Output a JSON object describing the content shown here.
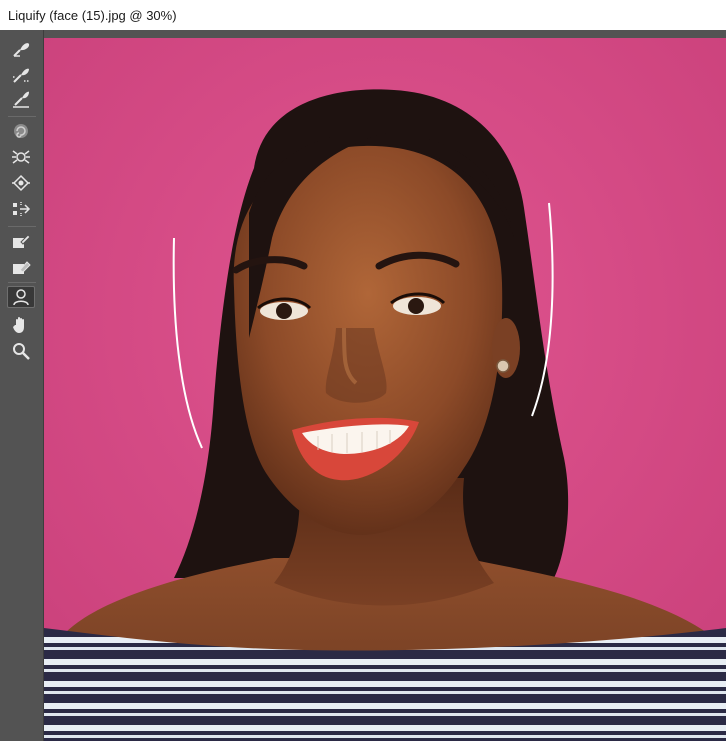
{
  "window": {
    "title": "Liquify (face (15).jpg @ 30%)"
  },
  "toolbar": {
    "tools": [
      {
        "name": "forward-warp-tool-icon",
        "label": "Forward Warp Tool"
      },
      {
        "name": "reconstruct-tool-icon",
        "label": "Reconstruct Tool"
      },
      {
        "name": "smooth-tool-icon",
        "label": "Smooth Tool"
      },
      {
        "name": "twirl-clockwise-tool-icon",
        "label": "Twirl Clockwise Tool"
      },
      {
        "name": "pucker-tool-icon",
        "label": "Pucker Tool"
      },
      {
        "name": "bloat-tool-icon",
        "label": "Bloat Tool"
      },
      {
        "name": "push-left-tool-icon",
        "label": "Push Left Tool"
      },
      {
        "name": "freeze-mask-tool-icon",
        "label": "Freeze Mask Tool"
      },
      {
        "name": "thaw-mask-tool-icon",
        "label": "Thaw Mask Tool"
      },
      {
        "name": "face-tool-icon",
        "label": "Face Tool"
      },
      {
        "name": "hand-tool-icon",
        "label": "Hand Tool"
      },
      {
        "name": "zoom-tool-icon",
        "label": "Zoom Tool"
      }
    ],
    "active_tool": "Face Tool"
  },
  "canvas": {
    "document": "face (15).jpg",
    "zoom": "30%",
    "colors": {
      "background_wall": "#d84d88",
      "skin": "#8a4a2a",
      "hair": "#1e1210",
      "lips": "#d8473a",
      "shirt_dark": "#2b2a45",
      "shirt_light": "#e8eef4"
    }
  }
}
